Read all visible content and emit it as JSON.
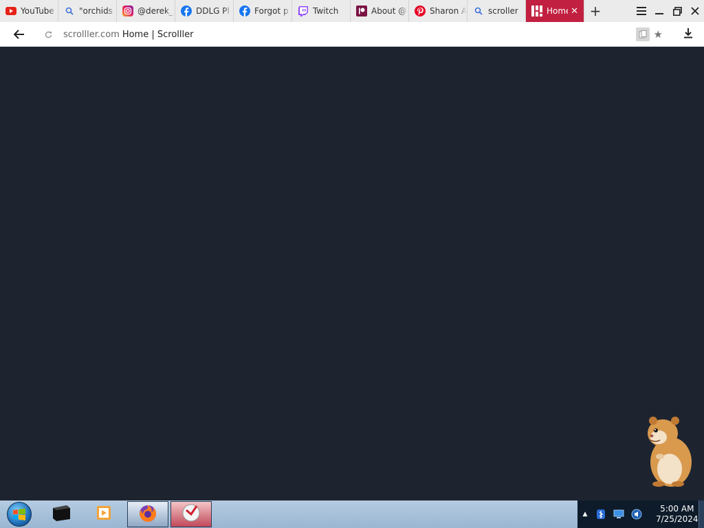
{
  "browser": {
    "tabs": [
      {
        "title": "YouTube",
        "icon": "youtube-icon",
        "active": false
      },
      {
        "title": "\"orchids",
        "icon": "search-icon",
        "active": false
      },
      {
        "title": "@derek_",
        "icon": "instagram-icon",
        "active": false
      },
      {
        "title": "DDLG Pl",
        "icon": "facebook-icon",
        "active": false
      },
      {
        "title": "Forgot p",
        "icon": "facebook-icon",
        "active": false
      },
      {
        "title": "Twitch",
        "icon": "twitch-icon",
        "active": false
      },
      {
        "title": "About @",
        "icon": "patreon-icon",
        "active": false
      },
      {
        "title": "Sharon A",
        "icon": "pinterest-icon",
        "active": false
      },
      {
        "title": "scroller",
        "icon": "search-icon",
        "active": false
      },
      {
        "title": "Home",
        "icon": "scrolller-icon",
        "active": true
      }
    ],
    "address": {
      "domain": "scrolller.com",
      "page_title": "Home | Scrolller"
    },
    "accent_color": "#c22040"
  },
  "page": {
    "background_color": "#1d2430"
  },
  "taskbar": {
    "clock_time": "5:00 AM",
    "clock_date": "7/25/2024"
  }
}
